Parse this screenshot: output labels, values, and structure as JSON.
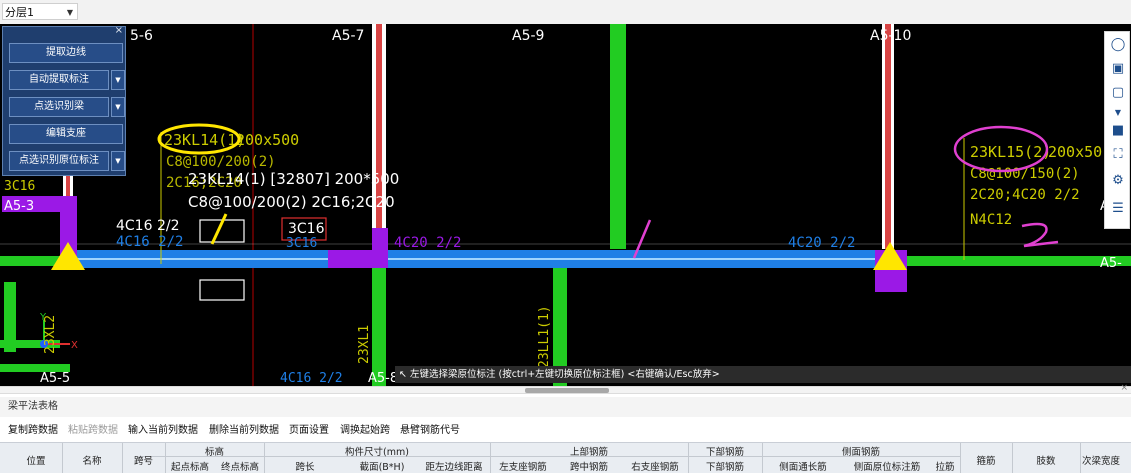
{
  "floor_select": {
    "value": "分层1"
  },
  "panel": {
    "close": "×",
    "buttons": [
      {
        "label": "提取边线"
      },
      {
        "label": "自动提取标注"
      },
      {
        "label": "点选识别梁"
      },
      {
        "label": "编辑支座"
      },
      {
        "label": "点选识别原位标注"
      }
    ],
    "dropdown_glyph": "▼"
  },
  "canvas": {
    "axis_labels": [
      "5-6",
      "A5-7",
      "A5-9",
      "A5-10",
      "A5-3",
      "A5-",
      "A5-5",
      "A5-8",
      "A"
    ],
    "beams": [
      {
        "name": "23KL14(1)",
        "size": "200x500",
        "stirrup": "C8@100/200(2)",
        "top": "2C16;2C20"
      },
      {
        "name": "23KL15(2)",
        "size": "200x50",
        "stirrup": "C8@100/150(2)",
        "top": "2C20;4C20 2/2",
        "side": "N4C12"
      }
    ],
    "tooltip": {
      "line1": "23KL14(1) [32807] 200*500",
      "line2": "C8@100/200(2) 2C16;2C20"
    },
    "labels": {
      "left_3c16": "3C16",
      "mid_left_4c16": "4C16 2/2",
      "mid_left_4c16_dim": "4C16 2/2",
      "red_box": "3C16",
      "red_box_dim": "3C16",
      "center_4c20": "4C20 2/2",
      "right_4c20": "4C20 2/2",
      "bottom_4c16": "4C16 2/2",
      "vertical_23xl2": "23XL2",
      "vertical_23xl1": "23XL1",
      "vertical_23ll1": "23LL1(1)"
    },
    "status": "左键选择梁原位标注 (按ctrl+左键切换原位标注框) <右键确认/Esc放弃>",
    "colors": {
      "beam_blue": "#1f7fe6",
      "column_purple": "#9b19e6",
      "wall_green": "#22cc22",
      "annot_yellow": "#cccc00",
      "support_yellow": "#ffe600",
      "magenta_ink": "#e040d0"
    },
    "hand_marks": [
      "/",
      "/",
      "2"
    ],
    "tools": [
      "lasso-icon",
      "3d-view-icon",
      "cube-icon",
      "chevron-down-icon",
      "cube-filled-icon",
      "fullscreen-icon",
      "gear-box-icon",
      "properties-icon"
    ]
  },
  "scroll": {
    "close": "×"
  },
  "pane": {
    "title": "梁平法表格",
    "toolbar": [
      {
        "label": "复制跨数据",
        "enabled": true
      },
      {
        "label": "粘贴跨数据",
        "enabled": false
      },
      {
        "label": "输入当前列数据",
        "enabled": true
      },
      {
        "label": "删除当前列数据",
        "enabled": true
      },
      {
        "label": "页面设置",
        "enabled": true
      },
      {
        "label": "调换起始跨",
        "enabled": true
      },
      {
        "label": "悬臂钢筋代号",
        "enabled": true
      }
    ],
    "headers": {
      "position": "位置",
      "name": "名称",
      "span": "跨号",
      "elevation": "标高",
      "elev_start": "起点标高",
      "elev_end": "终点标高",
      "dims": "构件尺寸(mm)",
      "span_len": "跨长",
      "section": "截面(B*H)",
      "edge_dist": "距左边线距离",
      "top_bars": "上部钢筋",
      "left_support": "左支座钢筋",
      "mid_bars": "跨中钢筋",
      "right_support": "右支座钢筋",
      "bottom_bars": "下部钢筋",
      "bottom_main": "下部钢筋",
      "side_bars": "侧面钢筋",
      "side_through": "侧面通长筋",
      "side_inplace": "侧面原位标注筋",
      "tie": "拉筋",
      "stirrup": "箍筋",
      "legs": "肢数",
      "secondary_width": "次梁宽度"
    }
  }
}
